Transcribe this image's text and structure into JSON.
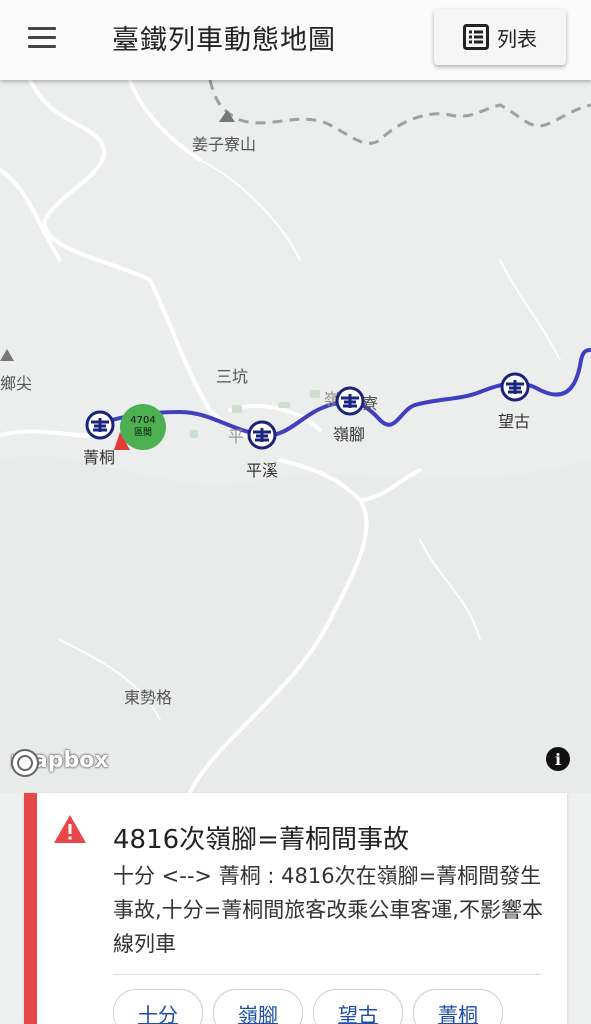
{
  "header": {
    "menu_icon": "hamburger-menu-icon",
    "title": "臺鐵列車動態地圖",
    "list_button_label": "列表",
    "list_icon": "list-icon"
  },
  "map": {
    "places": {
      "jiangzi": "姜子寮山",
      "sankeng": "三坑",
      "dongshige": "東勢格",
      "left_peak": "鄉尖",
      "ping_partial": "平",
      "lingjiao_partial": "嶺",
      "liao_partial": "寮"
    },
    "stations": {
      "jingtong": "菁桐",
      "pingxi": "平溪",
      "lingjiao": "嶺腳",
      "wanggu": "望古"
    },
    "train": {
      "number": "4704",
      "type": "區間",
      "color": "#4caf50"
    },
    "line_color": "#3f3fc0",
    "attribution_logo": "mapbox",
    "info_icon": "i"
  },
  "alert": {
    "icon": "warning-icon",
    "color": "#e8474a",
    "title": "4816次嶺腳=菁桐間事故",
    "body": "十分 <--> 菁桐 : 4816次在嶺腳=菁桐間發生事故,十分=菁桐間旅客改乘公車客運,不影響本線列車",
    "chips": [
      "十分",
      "嶺腳",
      "望古",
      "菁桐"
    ]
  }
}
